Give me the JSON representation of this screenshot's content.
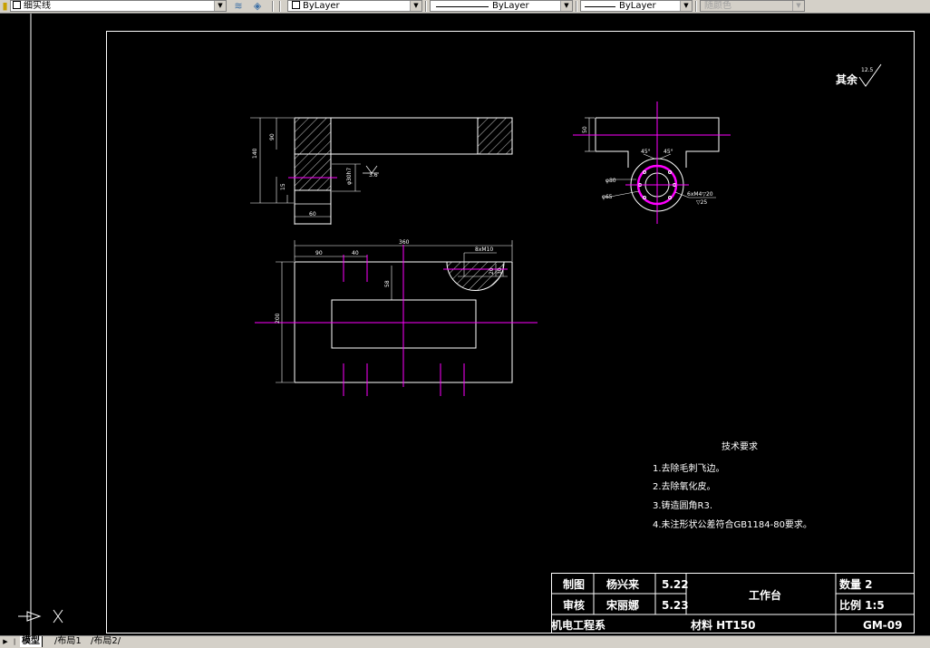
{
  "toolbar": {
    "layer_name": "细实线",
    "color_value": "ByLayer",
    "linetype_value": "ByLayer",
    "lineweight_value": "ByLayer",
    "plotstyle_value": "随颜色"
  },
  "drawing": {
    "dims": {
      "d140": "140",
      "d90": "90",
      "d50a": "50",
      "d60": "60",
      "d15": "15",
      "phi": "φ30h7",
      "r16": "3.6",
      "d360": "360",
      "d90b": "90",
      "d40": "40",
      "d200": "200",
      "d58": "58",
      "d8m": "8xM10",
      "d20": "20",
      "d30": "30",
      "d50b": "50",
      "a45a": "45°",
      "a45b": "45°",
      "phi80": "φ80",
      "phi65": "φ65",
      "m4": "6xM4▽20",
      "m4b": "▽25"
    },
    "surface_note": "其余",
    "surface_value": "12.5",
    "tech_title": "技术要求",
    "tech_notes": [
      "1.去除毛刺飞边。",
      "2.去除氧化皮。",
      "3.铸造圆角R3.",
      "4.未注形状公差符合GB1184-80要求。"
    ]
  },
  "title_block": {
    "drawn_label": "制图",
    "drawn_name": "杨兴来",
    "drawn_date": "5.22",
    "check_label": "审核",
    "check_name": "宋丽娜",
    "check_date": "5.23",
    "part_name": "工作台",
    "qty": "数量 2",
    "scale": "比例 1:5",
    "dept": "机电工程系",
    "material": "材料  HT150",
    "code": "GM-09"
  },
  "tabs": {
    "model": "模型",
    "layout1": "布局1",
    "layout2": "布局2"
  },
  "colors": {
    "background": "#000000",
    "geometry": "#ffffff",
    "centerline": "#ff00ff"
  },
  "icons": {
    "ucs": "ucs-icon",
    "nav_first": "nav-first-icon"
  }
}
